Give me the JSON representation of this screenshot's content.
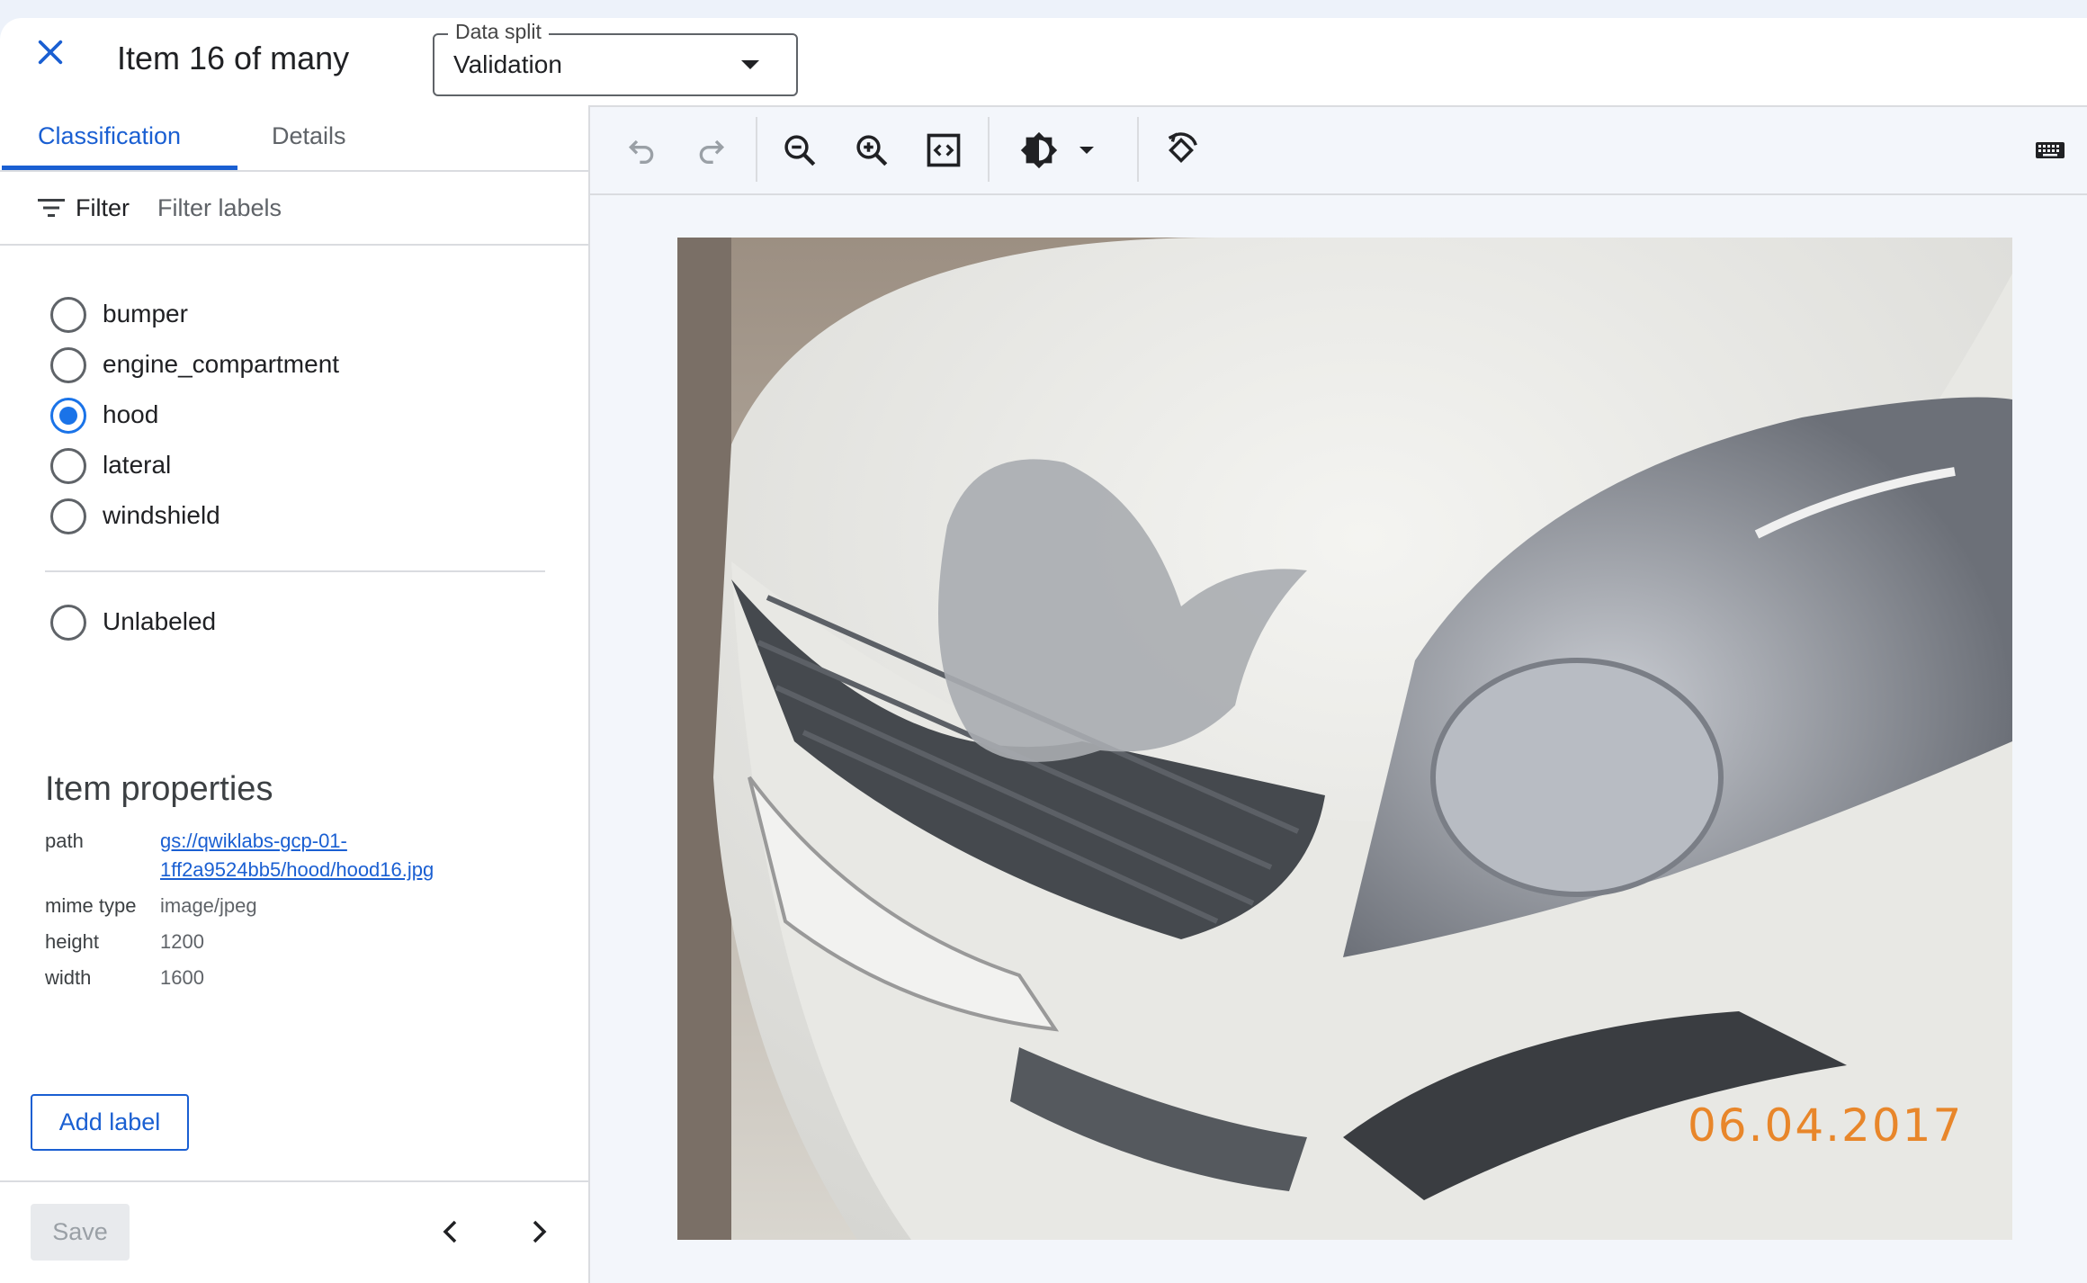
{
  "header": {
    "title": "Item 16 of many",
    "data_split": {
      "legend": "Data split",
      "value": "Validation"
    }
  },
  "tabs": [
    {
      "label": "Classification",
      "active": true
    },
    {
      "label": "Details",
      "active": false
    }
  ],
  "filter": {
    "label": "Filter",
    "placeholder": "Filter labels"
  },
  "labels": [
    {
      "label": "bumper",
      "selected": false
    },
    {
      "label": "engine_compartment",
      "selected": false
    },
    {
      "label": "hood",
      "selected": true
    },
    {
      "label": "lateral",
      "selected": false
    },
    {
      "label": "windshield",
      "selected": false
    }
  ],
  "unlabeled": {
    "label": "Unlabeled",
    "selected": false
  },
  "item_properties": {
    "title": "Item properties",
    "path_key": "path",
    "path_line1": "gs://qwiklabs-gcp-01-",
    "path_line2": "1ff2a9524bb5/hood/hood16.jpg",
    "mime_key": "mime type",
    "mime_value": "image/jpeg",
    "height_key": "height",
    "height_value": "1200",
    "width_key": "width",
    "width_value": "1600"
  },
  "buttons": {
    "add_label": "Add label",
    "save": "Save"
  },
  "toolbar_icons": [
    "undo-icon",
    "redo-icon",
    "zoom-out-icon",
    "zoom-in-icon",
    "fit-to-screen-icon",
    "brightness-icon",
    "dropdown-caret-icon",
    "rotate-icon",
    "keyboard-icon"
  ],
  "image": {
    "date_stamp": "06.04.2017",
    "description_colors": {
      "car": "#e6e6e2",
      "grille": "#4a4e52",
      "scratch": "#a9acb0",
      "background": "#8a857e"
    }
  },
  "colors": {
    "accent": "#1a5fd2",
    "radio_selected": "#1a73e8"
  }
}
